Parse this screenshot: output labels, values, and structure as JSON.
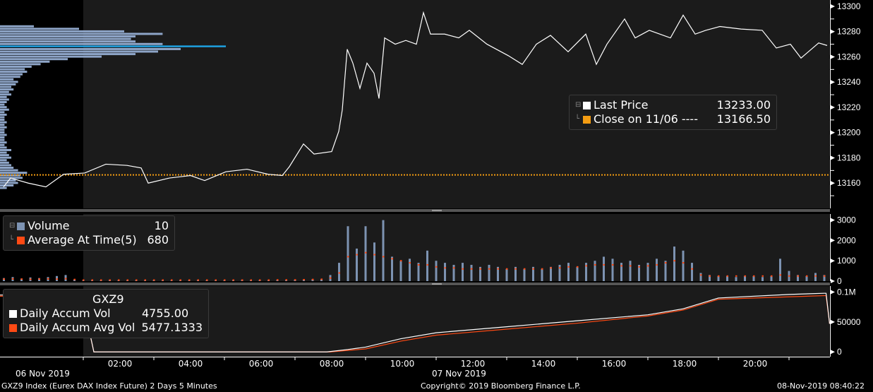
{
  "chart_data": [
    {
      "type": "line",
      "panel": "price",
      "title": "GXZ9 Index (Eurex DAX Index Future) 2 Days 5 Minutes",
      "x_unit": "hours from 07 Nov 2019 00:00",
      "ylim": [
        13140,
        13305
      ],
      "yticks": [
        13160,
        13180,
        13200,
        13220,
        13240,
        13260,
        13280,
        13300
      ],
      "series": [
        {
          "name": "Last Price",
          "value": "13233.00",
          "color": "#ffffff",
          "points": [
            [
              -2.26,
              13157
            ],
            [
              -2.06,
              13164
            ],
            [
              -1.56,
              13160
            ],
            [
              -1.06,
              13157
            ],
            [
              -0.56,
              13167
            ],
            [
              0.04,
              13168
            ],
            [
              0.64,
              13175
            ],
            [
              1.24,
              13174
            ],
            [
              1.64,
              13172
            ],
            [
              1.84,
              13160
            ],
            [
              2.44,
              13164
            ],
            [
              3.04,
              13166
            ],
            [
              3.44,
              13162
            ],
            [
              4.04,
              13169
            ],
            [
              4.64,
              13171
            ],
            [
              5.24,
              13167
            ],
            [
              5.64,
              13166
            ],
            [
              5.84,
              13173
            ],
            [
              6.24,
              13191
            ],
            [
              6.54,
              13183
            ],
            [
              7.04,
              13185
            ],
            [
              7.24,
              13201
            ],
            [
              7.34,
              13218
            ],
            [
              7.48,
              13266
            ],
            [
              7.64,
              13255
            ],
            [
              7.84,
              13235
            ],
            [
              8.04,
              13255
            ],
            [
              8.24,
              13247
            ],
            [
              8.38,
              13227
            ],
            [
              8.54,
              13275
            ],
            [
              8.84,
              13270
            ],
            [
              9.14,
              13273
            ],
            [
              9.44,
              13270
            ],
            [
              9.64,
              13295
            ],
            [
              9.84,
              13278
            ],
            [
              10.24,
              13278
            ],
            [
              10.64,
              13275
            ],
            [
              10.94,
              13281
            ],
            [
              11.44,
              13270
            ],
            [
              12.04,
              13261
            ],
            [
              12.44,
              13254
            ],
            [
              12.84,
              13270
            ],
            [
              13.24,
              13277
            ],
            [
              13.74,
              13264
            ],
            [
              14.24,
              13278
            ],
            [
              14.54,
              13254
            ],
            [
              14.84,
              13270
            ],
            [
              15.34,
              13290
            ],
            [
              15.64,
              13275
            ],
            [
              16.04,
              13281
            ],
            [
              16.64,
              13275
            ],
            [
              17.0,
              13293
            ],
            [
              17.34,
              13278
            ],
            [
              17.64,
              13281
            ],
            [
              18.04,
              13284
            ],
            [
              18.64,
              13282
            ],
            [
              19.24,
              13281
            ],
            [
              19.64,
              13267
            ],
            [
              20.04,
              13270
            ],
            [
              20.34,
              13259
            ],
            [
              20.84,
              13271
            ],
            [
              21.08,
              13269
            ]
          ]
        },
        {
          "name": "Close on 11/06 ----",
          "value": "13166.50",
          "color": "#f39c12",
          "level": 13166.5
        }
      ],
      "volume_profile": {
        "peak_price": 13268,
        "peak_color": "#1ea0e0",
        "levels": [
          [
            13156,
            0.03
          ],
          [
            13158,
            0.06
          ],
          [
            13160,
            0.08
          ],
          [
            13162,
            0.07
          ],
          [
            13164,
            0.1
          ],
          [
            13166,
            0.09
          ],
          [
            13168,
            0.12
          ],
          [
            13170,
            0.08
          ],
          [
            13172,
            0.06
          ],
          [
            13174,
            0.05
          ],
          [
            13176,
            0.04
          ],
          [
            13178,
            0.03
          ],
          [
            13180,
            0.05
          ],
          [
            13182,
            0.04
          ],
          [
            13184,
            0.03
          ],
          [
            13186,
            0.05
          ],
          [
            13188,
            0.03
          ],
          [
            13190,
            0.02
          ],
          [
            13192,
            0.03
          ],
          [
            13194,
            0.02
          ],
          [
            13196,
            0.02
          ],
          [
            13198,
            0.03
          ],
          [
            13200,
            0.02
          ],
          [
            13202,
            0.02
          ],
          [
            13204,
            0.03
          ],
          [
            13206,
            0.02
          ],
          [
            13208,
            0.03
          ],
          [
            13210,
            0.02
          ],
          [
            13212,
            0.02
          ],
          [
            13214,
            0.03
          ],
          [
            13216,
            0.02
          ],
          [
            13218,
            0.04
          ],
          [
            13220,
            0.03
          ],
          [
            13222,
            0.02
          ],
          [
            13224,
            0.03
          ],
          [
            13226,
            0.04
          ],
          [
            13228,
            0.03
          ],
          [
            13230,
            0.05
          ],
          [
            13232,
            0.04
          ],
          [
            13234,
            0.06
          ],
          [
            13236,
            0.05
          ],
          [
            13238,
            0.07
          ],
          [
            13240,
            0.08
          ],
          [
            13242,
            0.06
          ],
          [
            13244,
            0.09
          ],
          [
            13246,
            0.1
          ],
          [
            13248,
            0.12
          ],
          [
            13250,
            0.11
          ],
          [
            13252,
            0.14
          ],
          [
            13254,
            0.18
          ],
          [
            13256,
            0.22
          ],
          [
            13258,
            0.3
          ],
          [
            13260,
            0.45
          ],
          [
            13262,
            0.6
          ],
          [
            13264,
            0.7
          ],
          [
            13266,
            0.8
          ],
          [
            13268,
            1.0
          ],
          [
            13270,
            0.72
          ],
          [
            13272,
            0.6
          ],
          [
            13274,
            0.58
          ],
          [
            13276,
            0.6
          ],
          [
            13278,
            0.72
          ],
          [
            13280,
            0.55
          ],
          [
            13282,
            0.35
          ],
          [
            13284,
            0.15
          ]
        ]
      }
    },
    {
      "type": "bar",
      "panel": "volume",
      "ylim": [
        0,
        3300
      ],
      "yticks": [
        0,
        1000,
        2000,
        3000
      ],
      "x_start": -2.25,
      "x_step": 0.25,
      "series": [
        {
          "name": "Volume",
          "value": "10",
          "color": "#7d93b2",
          "values": [
            150,
            200,
            120,
            180,
            150,
            200,
            250,
            300,
            80,
            30,
            40,
            30,
            50,
            40,
            30,
            40,
            30,
            50,
            40,
            30,
            40,
            30,
            50,
            40,
            30,
            40,
            50,
            60,
            40,
            50,
            40,
            60,
            50,
            70,
            80,
            100,
            90,
            300,
            900,
            2700,
            1600,
            2700,
            1900,
            3000,
            1200,
            1000,
            1100,
            900,
            1500,
            1000,
            900,
            800,
            900,
            800,
            700,
            800,
            700,
            600,
            700,
            600,
            700,
            600,
            700,
            800,
            900,
            700,
            900,
            1000,
            1200,
            1100,
            900,
            1000,
            800,
            900,
            1100,
            1000,
            1700,
            1500,
            900,
            400,
            300,
            250,
            250,
            200,
            250,
            250,
            200,
            250,
            1100,
            500,
            300,
            250,
            400,
            300
          ]
        },
        {
          "name": "Average At Time(5)",
          "value": "680",
          "color": "#ff4a14",
          "values": [
            100,
            110,
            100,
            90,
            100,
            110,
            100,
            120,
            80,
            50,
            50,
            50,
            50,
            50,
            50,
            50,
            50,
            50,
            50,
            50,
            50,
            50,
            50,
            50,
            50,
            50,
            50,
            50,
            50,
            50,
            50,
            60,
            60,
            60,
            70,
            80,
            90,
            150,
            400,
            1200,
            1300,
            1400,
            1300,
            1200,
            1100,
            1000,
            900,
            800,
            800,
            700,
            650,
            650,
            600,
            600,
            600,
            600,
            600,
            600,
            600,
            600,
            600,
            600,
            650,
            650,
            700,
            700,
            750,
            800,
            800,
            800,
            750,
            750,
            700,
            750,
            800,
            900,
            1000,
            900,
            600,
            300,
            250,
            250,
            250,
            250,
            250,
            250,
            250,
            250,
            300,
            250,
            250,
            250,
            250,
            250
          ]
        }
      ]
    },
    {
      "type": "line",
      "panel": "accumulated",
      "title": "GXZ9",
      "ylim": [
        -8000,
        110000
      ],
      "yticks": [
        0,
        50000,
        100000
      ],
      "ytick_labels": [
        "0",
        "50000",
        "0.1M"
      ],
      "series": [
        {
          "name": "Daily Accum Vol",
          "value": "4755.00",
          "color": "#ffffff",
          "points": [
            [
              -2.4,
              95000
            ],
            [
              -0.05,
              95500
            ],
            [
              0.3,
              0
            ],
            [
              6.9,
              0
            ],
            [
              7.5,
              4000
            ],
            [
              8,
              8000
            ],
            [
              9,
              22000
            ],
            [
              10,
              32000
            ],
            [
              12,
              42000
            ],
            [
              14,
              52000
            ],
            [
              16,
              62000
            ],
            [
              17,
              72000
            ],
            [
              18,
              90000
            ],
            [
              20,
              96000
            ],
            [
              21,
              98000
            ],
            [
              21.05,
              98000
            ],
            [
              21.15,
              47000
            ]
          ]
        },
        {
          "name": "Daily Accum Avg Vol",
          "value": "5477.1333",
          "color": "#ff4a14",
          "points": [
            [
              -2.4,
              93000
            ],
            [
              -0.05,
              93500
            ],
            [
              0.3,
              0
            ],
            [
              7.0,
              0
            ],
            [
              8,
              5000
            ],
            [
              9,
              18000
            ],
            [
              10,
              28000
            ],
            [
              12,
              38000
            ],
            [
              14,
              48000
            ],
            [
              16,
              60000
            ],
            [
              17,
              70000
            ],
            [
              18,
              88000
            ],
            [
              20,
              92000
            ],
            [
              21,
              94000
            ],
            [
              21.05,
              94000
            ],
            [
              21.15,
              47000
            ]
          ]
        }
      ]
    }
  ],
  "x_axis": {
    "labels": [
      "02:00",
      "04:00",
      "06:00",
      "08:00",
      "10:00",
      "12:00",
      "14:00",
      "16:00",
      "18:00",
      "20:00"
    ],
    "date_left": "06 Nov 2019",
    "date_center": "07 Nov 2019"
  },
  "footer": {
    "left": "GXZ9 Index (Eurex DAX Index Future) 2 Days 5 Minutes",
    "center": "Copyright© 2019 Bloomberg Finance L.P.",
    "right": "08-Nov-2019 08:40:22"
  }
}
